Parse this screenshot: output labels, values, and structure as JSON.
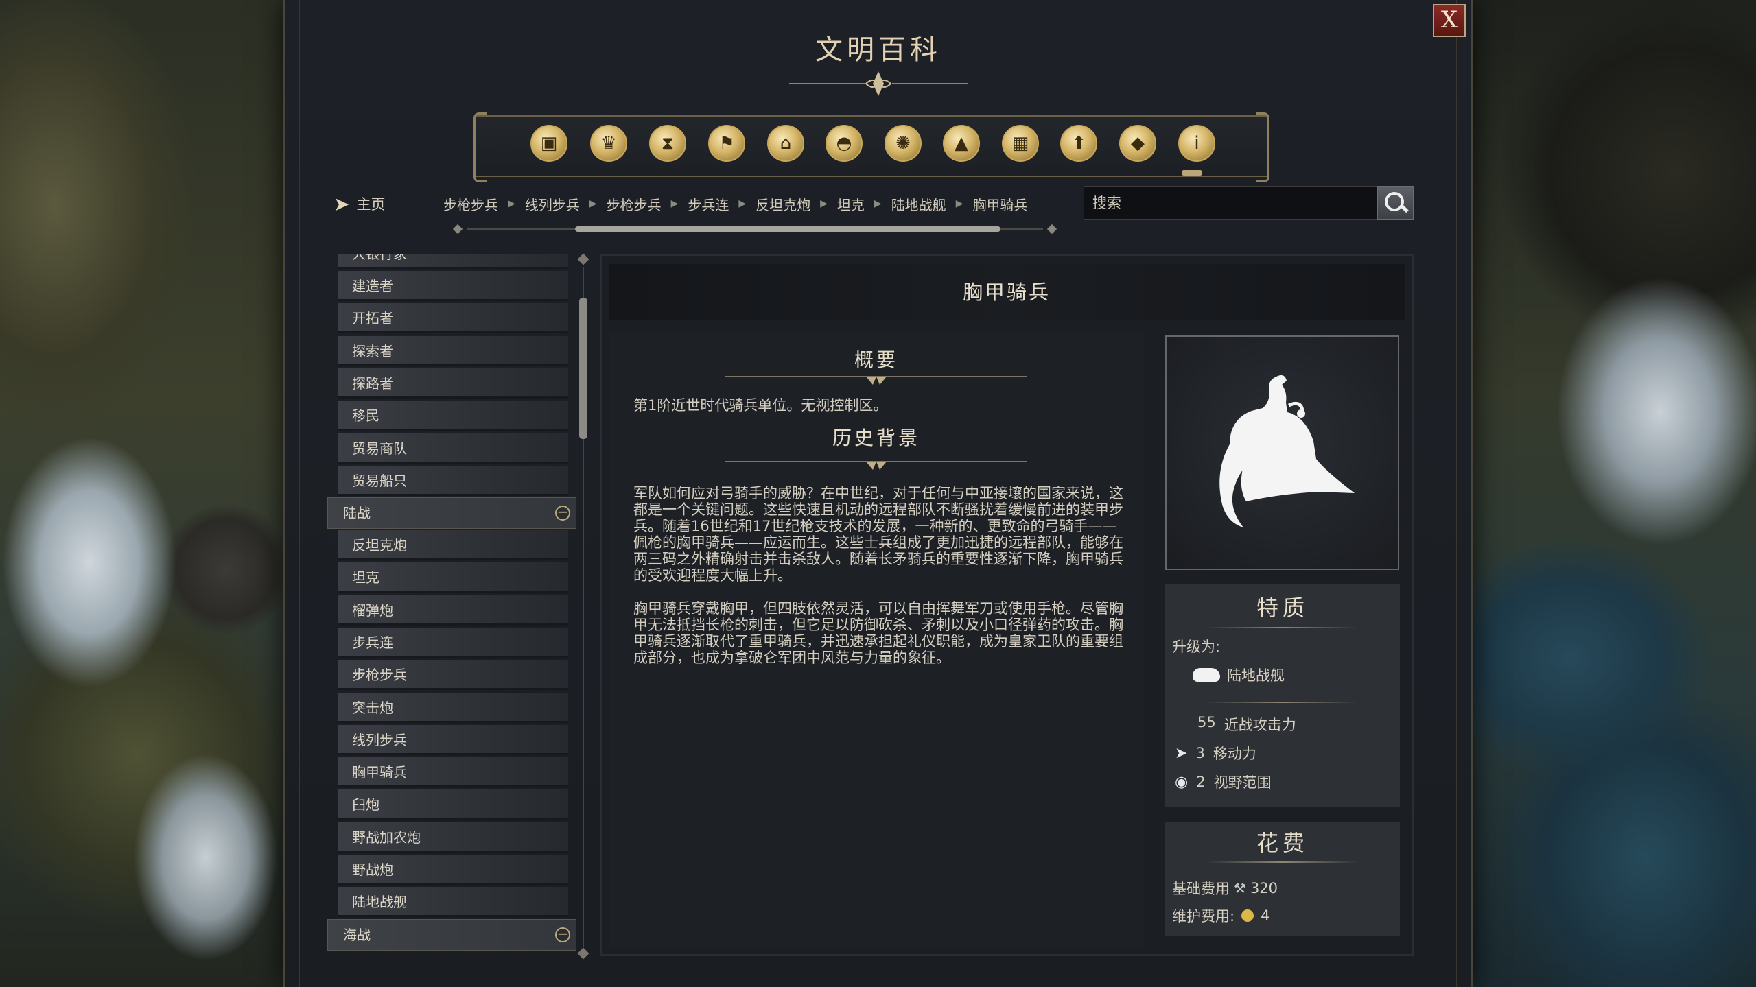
{
  "window": {
    "title": "文明百科",
    "close_label": "X"
  },
  "categories": [
    {
      "name": "units-icon",
      "glyph": "▣"
    },
    {
      "name": "goods-icon",
      "glyph": "♛"
    },
    {
      "name": "era-icon",
      "glyph": "⧗"
    },
    {
      "name": "civilization-icon",
      "glyph": "⚑"
    },
    {
      "name": "buildings-icon",
      "glyph": "⌂"
    },
    {
      "name": "technology-icon",
      "glyph": "◓"
    },
    {
      "name": "science-icon",
      "glyph": "✺"
    },
    {
      "name": "terrain-icon",
      "glyph": "▲"
    },
    {
      "name": "city-icon",
      "glyph": "▦"
    },
    {
      "name": "upgrade-icon",
      "glyph": "⬆"
    },
    {
      "name": "resources-icon",
      "glyph": "◆"
    },
    {
      "name": "info-icon",
      "glyph": "i"
    }
  ],
  "nav": {
    "home_label": "主页",
    "breadcrumbs": [
      "步枪步兵",
      "线列步兵",
      "步枪步兵",
      "步兵连",
      "反坦克炮",
      "坦克",
      "陆地战舰",
      "胸甲骑兵"
    ],
    "search_placeholder": "搜索"
  },
  "sidebar": {
    "partial_top": "大银行家",
    "items_top": [
      "建造者",
      "开拓者",
      "探索者",
      "探路者",
      "移民",
      "贸易商队",
      "贸易船只"
    ],
    "category_land": "陆战",
    "items_land": [
      "反坦克炮",
      "坦克",
      "榴弹炮",
      "步兵连",
      "步枪步兵",
      "突击炮",
      "线列步兵",
      "胸甲骑兵",
      "臼炮",
      "野战加农炮",
      "野战炮",
      "陆地战舰"
    ],
    "category_naval": "海战"
  },
  "unit": {
    "name": "胸甲骑兵",
    "summary_heading": "概要",
    "summary_text": "第1阶近世时代骑兵单位。无视控制区。",
    "history_heading": "历史背景",
    "history_p1": "军队如何应对弓骑手的威胁？在中世纪，对于任何与中亚接壤的国家来说，这都是一个关键问题。这些快速且机动的远程部队不断骚扰着缓慢前进的装甲步兵。随着16世纪和17世纪枪支技术的发展，一种新的、更致命的弓骑手——佩枪的胸甲骑兵——应运而生。这些士兵组成了更加迅捷的远程部队，能够在两三码之外精确射击并击杀敌人。随着长矛骑兵的重要性逐渐下降，胸甲骑兵的受欢迎程度大幅上升。",
    "history_p2": "胸甲骑兵穿戴胸甲，但四肢依然灵活，可以自由挥舞军刀或使用手枪。尽管胸甲无法抵挡长枪的刺击，但它足以防御砍杀、矛刺以及小口径弹药的攻击。胸甲骑兵逐渐取代了重甲骑兵，并迅速承担起礼仪职能，成为皇家卫队的重要组成部分，也成为拿破仑军团中风范与力量的象征。",
    "portrait_icon": "cuirassier-helmet-icon"
  },
  "traits": {
    "heading": "特质",
    "upgrade_label": "升级为:",
    "upgrade_target": "陆地战舰",
    "melee_value": "55",
    "melee_label": "近战攻击力",
    "move_value": "3",
    "move_label": "移动力",
    "sight_value": "2",
    "sight_label": "视野范围"
  },
  "cost": {
    "heading": "花费",
    "base_label": "基础费用",
    "base_value": "320",
    "upkeep_label": "维护费用:",
    "upkeep_value": "4"
  },
  "colors": {
    "accent_gold": "#d6b76a",
    "close_red": "#8a2a25",
    "panel_bg": "#1b1e22"
  }
}
